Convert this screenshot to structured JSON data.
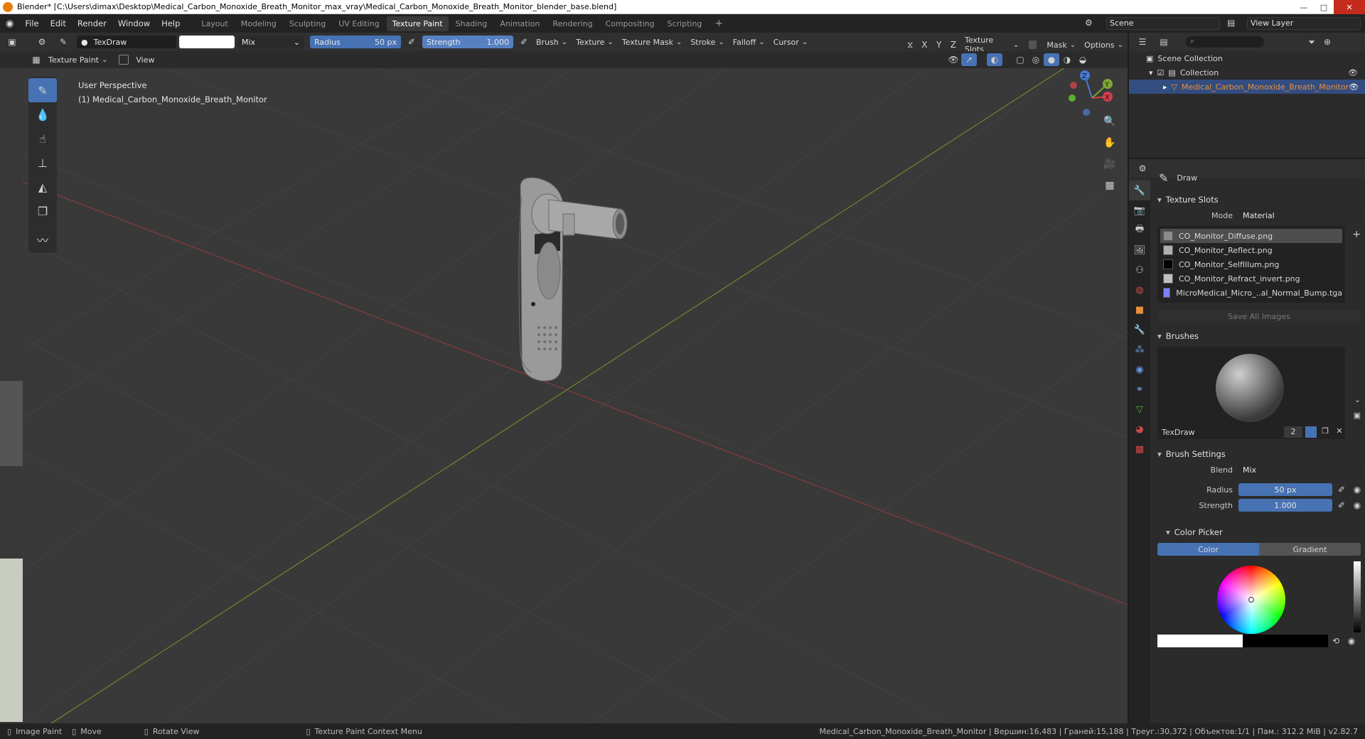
{
  "window": {
    "title": "Blender* [C:\\Users\\dimax\\Desktop\\Medical_Carbon_Monoxide_Breath_Monitor_max_vray\\Medical_Carbon_Monoxide_Breath_Monitor_blender_base.blend]"
  },
  "menu": [
    "File",
    "Edit",
    "Render",
    "Window",
    "Help"
  ],
  "workspaces": [
    "Layout",
    "Modeling",
    "Sculpting",
    "UV Editing",
    "Texture Paint",
    "Shading",
    "Animation",
    "Rendering",
    "Compositing",
    "Scripting"
  ],
  "active_workspace": "Texture Paint",
  "scene": "Scene",
  "view_layer": "View Layer",
  "tool_header": {
    "brush_name": "TexDraw",
    "blend": "Mix",
    "radius_label": "Radius",
    "radius_value": "50 px",
    "strength_label": "Strength",
    "strength_value": "1.000",
    "menus": [
      "Brush",
      "Texture",
      "Texture Mask",
      "Stroke",
      "Falloff",
      "Cursor"
    ],
    "axes": [
      "X",
      "Y",
      "Z"
    ],
    "texture_slots": "Texture Slots",
    "mask": "Mask",
    "options": "Options"
  },
  "header2": {
    "mode": "Texture Paint",
    "view": "View"
  },
  "viewport": {
    "perspective": "User Perspective",
    "object": "(1) Medical_Carbon_Monoxide_Breath_Monitor"
  },
  "outliner": {
    "scene_collection": "Scene Collection",
    "collection": "Collection",
    "object": "Medical_Carbon_Monoxide_Breath_Monitor"
  },
  "properties": {
    "tool_name": "Draw",
    "texture_slots_title": "Texture Slots",
    "mode_label": "Mode",
    "mode_value": "Material",
    "slots": [
      {
        "name": "CO_Monitor_Diffuse.png",
        "color": "#8a8a8a"
      },
      {
        "name": "CO_Monitor_Reflect.png",
        "color": "#b0b0b0"
      },
      {
        "name": "CO_Monitor_SelfIllum.png",
        "color": "#000000"
      },
      {
        "name": "CO_Monitor_Refract_invert.png",
        "color": "#c0c0c0"
      },
      {
        "name": "MicroMedical_Micro_..al_Normal_Bump.tga",
        "color": "#8080ff"
      }
    ],
    "save_all": "Save All Images",
    "brushes_title": "Brushes",
    "brush_name": "TexDraw",
    "brush_users": "2",
    "brush_settings_title": "Brush Settings",
    "blend_label": "Blend",
    "blend_value": "Mix",
    "radius_label": "Radius",
    "radius_value": "50 px",
    "strength_label": "Strength",
    "strength_value": "1.000",
    "color_picker_title": "Color Picker",
    "color_tab": "Color",
    "gradient_tab": "Gradient"
  },
  "statusbar": {
    "image_paint": "Image Paint",
    "move": "Move",
    "rotate": "Rotate View",
    "context": "Texture Paint Context Menu",
    "stats": "Medical_Carbon_Monoxide_Breath_Monitor | Вершин:16,483 | Граней:15,188 | Треуг.:30,372 | Объектов:1/1 | Пам.: 312.2 MiB | v2.82.7"
  },
  "colors": {
    "accent": "#4772b3",
    "selected": "#334d80",
    "object_orange": "#e8903a"
  }
}
